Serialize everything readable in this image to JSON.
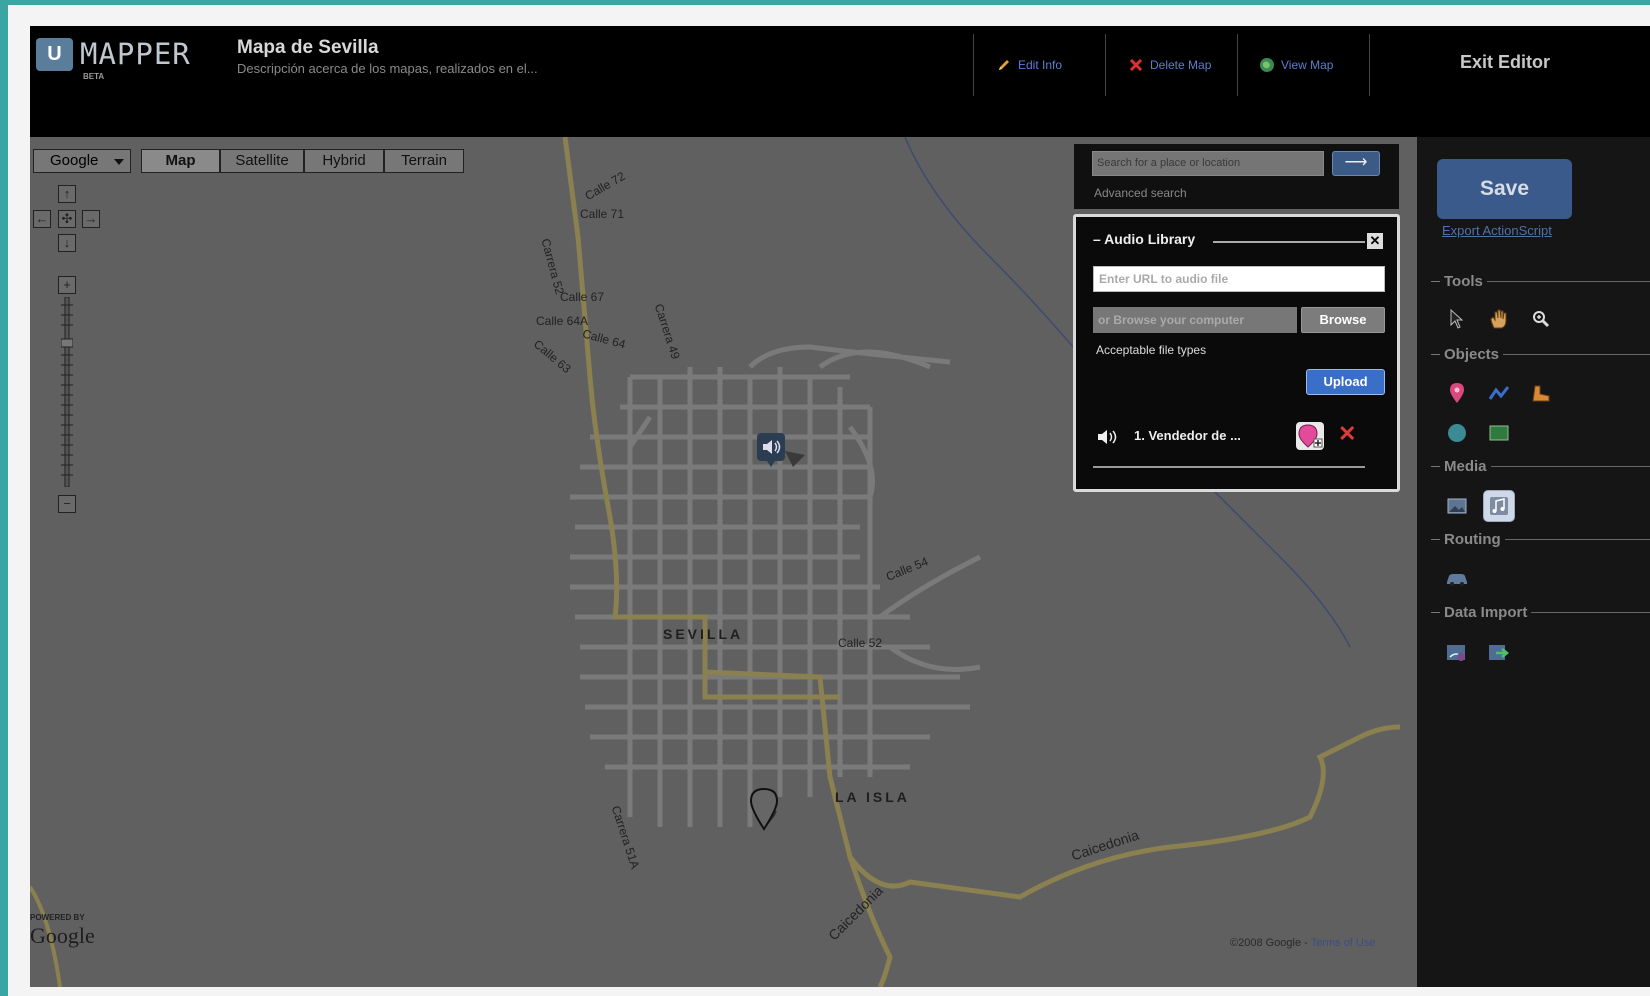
{
  "header": {
    "logo_badge": "U",
    "logo_text": "MAPPER",
    "logo_beta": "BETA",
    "map_title": "Mapa de Sevilla",
    "map_description": "Descripción acerca de los mapas, realizados en el...",
    "edit_info": "Edit Info",
    "delete_map": "Delete Map",
    "view_map": "View Map",
    "exit_editor": "Exit Editor"
  },
  "map": {
    "provider": "Google",
    "types": [
      "Map",
      "Satellite",
      "Hybrid",
      "Terrain"
    ],
    "active_type": "Map",
    "streets": [
      "Calle 72",
      "Calle 71",
      "Carrera 52",
      "Calle 67",
      "Calle 64A",
      "Calle 64",
      "Calle 63",
      "Carrera 49",
      "Calle 54",
      "Calle 52",
      "Carrera 51A",
      "Caicedonia",
      "Caicedonia"
    ],
    "towns": [
      "SEVILLA",
      "LA ISLA"
    ],
    "attribution_powered": "POWERED BY",
    "attribution_google": "Google",
    "copyright": "©2008 Google - ",
    "terms": "Terms of Use"
  },
  "search": {
    "placeholder": "Search for a place or location",
    "go_symbol": "⟶",
    "advanced": "Advanced search"
  },
  "audio_library": {
    "title": "Audio Library",
    "close_symbol": "✕",
    "url_placeholder": "Enter URL to audio file",
    "browse_placeholder": "or Browse your computer",
    "browse_button": "Browse",
    "acceptable_types": "Acceptable file types",
    "upload_button": "Upload",
    "items": [
      {
        "name": "1. Vendedor de ..."
      }
    ],
    "delete_symbol": "✕"
  },
  "sidebar": {
    "save": "Save",
    "export": "Export ActionScript",
    "sections": {
      "tools": "Tools",
      "objects": "Objects",
      "media": "Media",
      "routing": "Routing",
      "data_import": "Data Import"
    }
  },
  "colors": {
    "accent_blue": "#3a6fc9",
    "delete_red": "#e23a3a",
    "teal_border": "#3aa6a4"
  }
}
